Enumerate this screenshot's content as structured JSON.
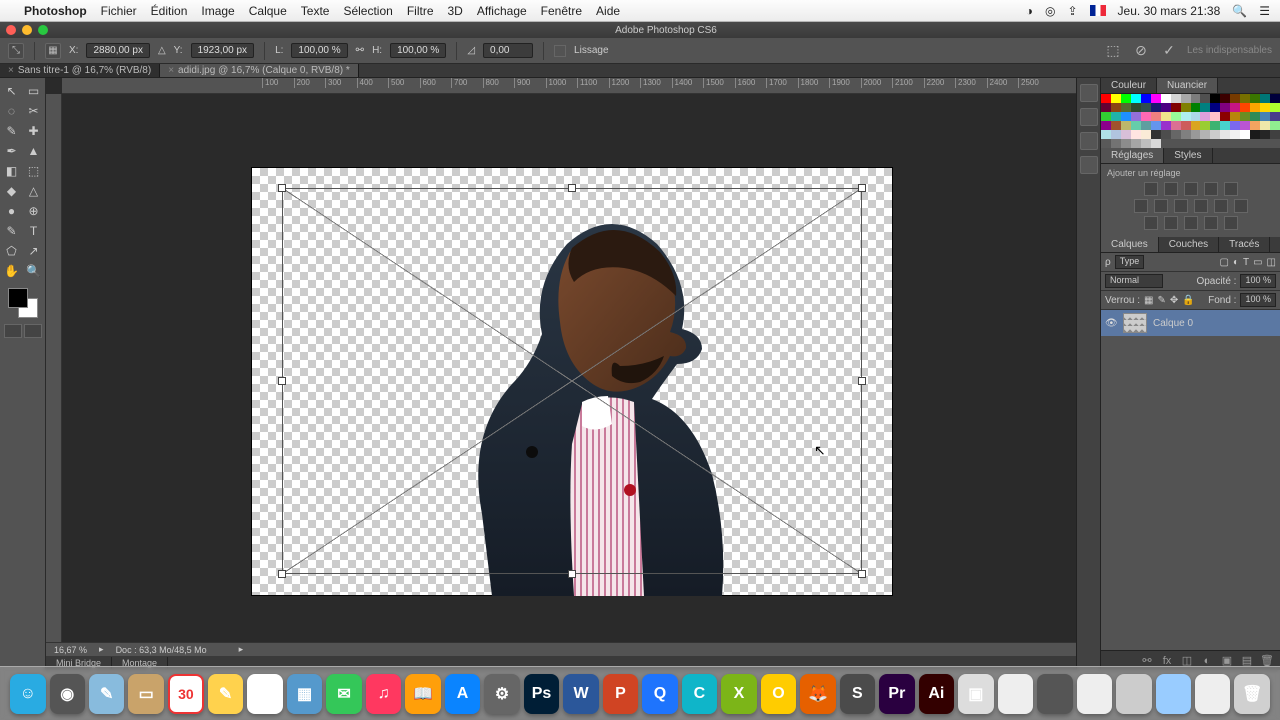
{
  "mac_menu": {
    "app": "Photoshop",
    "items": [
      "Fichier",
      "Édition",
      "Image",
      "Calque",
      "Texte",
      "Sélection",
      "Filtre",
      "3D",
      "Affichage",
      "Fenêtre",
      "Aide"
    ],
    "clock": "Jeu. 30 mars  21:38"
  },
  "window": {
    "title": "Adobe Photoshop CS6"
  },
  "options": {
    "x": "2880,00 px",
    "y": "1923,00 px",
    "w": "100,00 %",
    "h": "100,00 %",
    "angle": "0,00",
    "lissage": "Lissage",
    "right": "Les indispensables"
  },
  "doc_tabs": [
    {
      "name": "Sans titre-1 @ 16,7% (RVB/8)",
      "active": false
    },
    {
      "name": "adidi.jpg @ 16,7% (Calque 0, RVB/8) *",
      "active": true
    }
  ],
  "ruler_h": [
    100,
    200,
    300,
    400,
    500,
    600,
    700,
    800,
    900,
    1000,
    1100,
    1200,
    1300,
    1400,
    1500,
    1600,
    1700,
    1800,
    1900,
    2000,
    2100,
    2200,
    2300,
    2400,
    2500
  ],
  "status": {
    "zoom": "16,67 %",
    "doc": "Doc : 63,3 Mo/48,5 Mo"
  },
  "bottom_tabs": [
    "Mini Bridge",
    "Montage"
  ],
  "panels": {
    "color_tabs": [
      "Couleur",
      "Nuancier"
    ],
    "adjust_tabs": [
      "Réglages",
      "Styles"
    ],
    "adjust_label": "Ajouter un réglage",
    "layer_tabs": [
      "Calques",
      "Couches",
      "Tracés"
    ],
    "filter_label": "Type",
    "blend_mode": "Normal",
    "opacity_label": "Opacité :",
    "opacity": "100 %",
    "lock_label": "Verrou :",
    "fill_label": "Fond :",
    "fill": "100 %",
    "layer_name": "Calque 0"
  },
  "swatch_colors": [
    "#ff0000",
    "#ffff00",
    "#00ff00",
    "#00ffff",
    "#0000ff",
    "#ff00ff",
    "#ffffff",
    "#d4d4d4",
    "#a8a8a8",
    "#7c7c7c",
    "#505050",
    "#000000",
    "#3b0000",
    "#763a00",
    "#766f00",
    "#3a7600",
    "#007676",
    "#00003b",
    "#660033",
    "#8b4513",
    "#556b2f",
    "#2e4a2e",
    "#2f4f4f",
    "#191970",
    "#4b0082",
    "#800000",
    "#808000",
    "#008000",
    "#008080",
    "#000080",
    "#800080",
    "#c71585",
    "#ff4500",
    "#ffa500",
    "#ffd700",
    "#adff2f",
    "#32cd32",
    "#20b2aa",
    "#1e90ff",
    "#9370db",
    "#ff69b4",
    "#f08080",
    "#f0e68c",
    "#98fb98",
    "#afeeee",
    "#add8e6",
    "#dda0dd",
    "#ffc0cb",
    "#8b0000",
    "#b8860b",
    "#6b8e23",
    "#2e8b57",
    "#4682b4",
    "#483d8b",
    "#8b008b",
    "#a0522d",
    "#bdb76b",
    "#66cdaa",
    "#5f9ea0",
    "#6495ed",
    "#9932cc",
    "#db7093",
    "#cd5c5c",
    "#daa520",
    "#9acd32",
    "#3cb371",
    "#48d1cc",
    "#7b68ee",
    "#ba55d3",
    "#f4a460",
    "#eee8aa",
    "#90ee90",
    "#b0e0e6",
    "#b0c4de",
    "#d8bfd8",
    "#ffe4e1",
    "#faebd7",
    "#333333",
    "#4d4d4d",
    "#666666",
    "#808080",
    "#999999",
    "#b3b3b3",
    "#cccccc",
    "#e6e6e6",
    "#f2f2f2",
    "#ffffff",
    "#1a1a1a",
    "#262626",
    "#404040",
    "#595959",
    "#737373",
    "#8c8c8c",
    "#a6a6a6",
    "#bfbfbf",
    "#d9d9d9"
  ],
  "dock_apps": [
    {
      "bg": "#29abe2",
      "t": "☺"
    },
    {
      "bg": "#555",
      "t": "◉"
    },
    {
      "bg": "#8bd",
      "t": "✎"
    },
    {
      "bg": "#c9a36a",
      "t": "▭"
    },
    {
      "bg": "#fff",
      "t": "30"
    },
    {
      "bg": "#ffd24d",
      "t": "✎"
    },
    {
      "bg": "#fff",
      "t": "☰"
    },
    {
      "bg": "#59c",
      "t": "▦"
    },
    {
      "bg": "#34c759",
      "t": "✉"
    },
    {
      "bg": "#ff3860",
      "t": "♫"
    },
    {
      "bg": "#ff9f0a",
      "t": "📖"
    },
    {
      "bg": "#0a84ff",
      "t": "A"
    },
    {
      "bg": "#666",
      "t": "⚙"
    },
    {
      "bg": "#001e36",
      "t": "Ps"
    },
    {
      "bg": "#2b579a",
      "t": "W"
    },
    {
      "bg": "#d04423",
      "t": "P"
    },
    {
      "bg": "#1e74fd",
      "t": "Q"
    },
    {
      "bg": "#0fb5c9",
      "t": "C"
    },
    {
      "bg": "#7cb518",
      "t": "X"
    },
    {
      "bg": "#ffcc00",
      "t": "O"
    },
    {
      "bg": "#e66000",
      "t": "🦊"
    },
    {
      "bg": "#4b4b4b",
      "t": "S"
    },
    {
      "bg": "#2a0040",
      "t": "Pr"
    },
    {
      "bg": "#330000",
      "t": "Ai"
    },
    {
      "bg": "#ddd",
      "t": "▣"
    },
    {
      "bg": "#eee",
      "t": ""
    },
    {
      "bg": "#555",
      "t": ""
    },
    {
      "bg": "#eee",
      "t": ""
    },
    {
      "bg": "#ccc",
      "t": ""
    },
    {
      "bg": "#9cf",
      "t": ""
    },
    {
      "bg": "#eee",
      "t": ""
    },
    {
      "bg": "#d0d0d0",
      "t": "🗑"
    }
  ]
}
